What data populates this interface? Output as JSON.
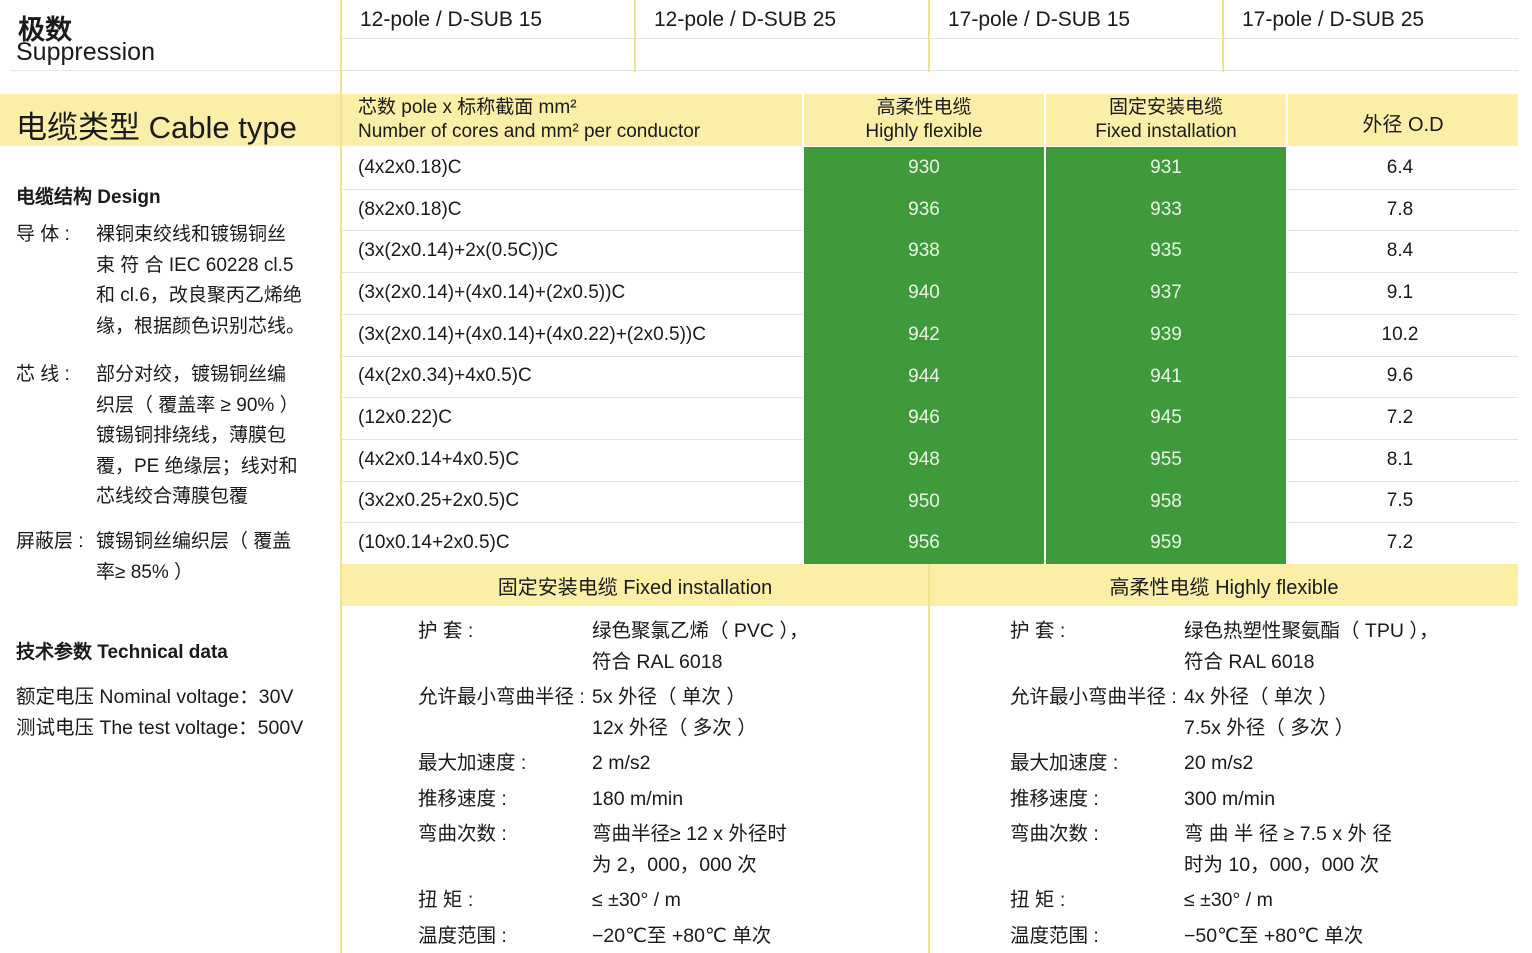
{
  "top_left": {
    "title": "极数",
    "subtitle": "Suppression"
  },
  "connectors": [
    "12-pole / D-SUB 15",
    "12-pole / D-SUB 25",
    "17-pole / D-SUB 15",
    "17-pole / D-SUB 25"
  ],
  "cable_type_label": "电缆类型 Cable type",
  "columns": {
    "cores_cn": "芯数 pole x 标称截面 mm²",
    "cores_en": "Number of cores and mm² per conductor",
    "flex_cn": "高柔性电缆",
    "flex_en": "Highly flexible",
    "fixed_cn": "固定安装电缆",
    "fixed_en": "Fixed installation",
    "od": "外径 O.D"
  },
  "rows": [
    {
      "spec": "(4x2x0.18)C",
      "flex": "930",
      "fixed": "931",
      "od": "6.4"
    },
    {
      "spec": "(8x2x0.18)C",
      "flex": "936",
      "fixed": "933",
      "od": "7.8"
    },
    {
      "spec": "(3x(2x0.14)+2x(0.5C))C",
      "flex": "938",
      "fixed": "935",
      "od": "8.4"
    },
    {
      "spec": "(3x(2x0.14)+(4x0.14)+(2x0.5))C",
      "flex": "940",
      "fixed": "937",
      "od": "9.1"
    },
    {
      "spec": "(3x(2x0.14)+(4x0.14)+(4x0.22)+(2x0.5))C",
      "flex": "942",
      "fixed": "939",
      "od": "10.2"
    },
    {
      "spec": "(4x(2x0.34)+4x0.5)C",
      "flex": "944",
      "fixed": "941",
      "od": "9.6"
    },
    {
      "spec": "(12x0.22)C",
      "flex": "946",
      "fixed": "945",
      "od": "7.2"
    },
    {
      "spec": "(4x2x0.14+4x0.5)C",
      "flex": "948",
      "fixed": "955",
      "od": "8.1"
    },
    {
      "spec": "(3x2x0.25+2x0.5)C",
      "flex": "950",
      "fixed": "958",
      "od": "7.5"
    },
    {
      "spec": "(10x0.14+2x0.5)C",
      "flex": "956",
      "fixed": "959",
      "od": "7.2"
    }
  ],
  "design": {
    "heading": "电缆结构  Design",
    "conductor_label": "导  体 :",
    "conductor_lines": [
      "裸铜束绞线和镀锡铜丝",
      "束 符 合 IEC 60228 cl.5",
      "和 cl.6，改良聚丙乙烯绝",
      "缘，根据颜色识别芯线。"
    ],
    "core_label": "芯  线 :",
    "core_lines": [
      "部分对绞，镀锡铜丝编",
      "织层（ 覆盖率 ≥ 90% ）",
      "镀锡铜排绕线，薄膜包",
      "覆，PE 绝缘层；线对和",
      "芯线绞合薄膜包覆"
    ],
    "shield_label": "屏蔽层 :",
    "shield_lines": [
      "镀锡铜丝编织层（ 覆盖",
      "率≥ 85% ）"
    ]
  },
  "technical": {
    "heading": "技术参数  Technical data",
    "nominal": "额定电压 Nominal voltage：30V",
    "test": "测试电压 The test voltage：500V"
  },
  "fixed_section": {
    "header": "固定安装电缆  Fixed installation",
    "items": [
      {
        "label": "护      套 :",
        "lines": [
          "绿色聚氯乙烯（ PVC ），",
          "符合 RAL 6018"
        ]
      },
      {
        "label": "允许最小弯曲半径 :",
        "lines": [
          "5x 外径（ 单次 ）",
          "12x 外径（ 多次 ）"
        ]
      },
      {
        "label": "最大加速度 :",
        "lines": [
          "2 m/s2"
        ]
      },
      {
        "label": "推移速度 :",
        "lines": [
          "180 m/min"
        ]
      },
      {
        "label": "弯曲次数 :",
        "lines": [
          "弯曲半径≥ 12 x 外径时",
          "为 2，000，000 次"
        ]
      },
      {
        "label": "扭      矩 :",
        "lines": [
          "≤ ±30°  / m"
        ]
      },
      {
        "label": "温度范围 :",
        "lines": [
          "−20℃至 +80℃ 单次"
        ]
      }
    ]
  },
  "flex_section": {
    "header": "高柔性电缆  Highly flexible",
    "items": [
      {
        "label": "护      套 :",
        "lines": [
          "绿色热塑性聚氨酯（ TPU ），",
          "符合 RAL 6018"
        ]
      },
      {
        "label": "允许最小弯曲半径 :",
        "lines": [
          "4x 外径（ 单次 ）",
          "7.5x 外径（ 多次 ）"
        ]
      },
      {
        "label": "最大加速度 :",
        "lines": [
          "20 m/s2"
        ]
      },
      {
        "label": "推移速度 :",
        "lines": [
          "300 m/min"
        ]
      },
      {
        "label": "弯曲次数 :",
        "lines": [
          "弯 曲 半 径 ≥ 7.5  x  外 径",
          "时为 10，000，000 次"
        ]
      },
      {
        "label": "扭      矩 :",
        "lines": [
          "≤ ±30°  / m"
        ]
      },
      {
        "label": "温度范围 :",
        "lines": [
          "−50℃至 +80℃ 单次"
        ]
      }
    ]
  },
  "colors": {
    "yellow": "#fbeea7",
    "green": "#3f9a3b",
    "divider": "#f3e28c"
  }
}
